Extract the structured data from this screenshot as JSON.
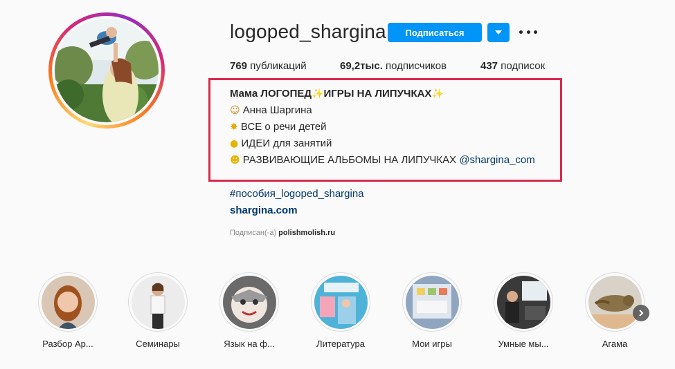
{
  "profile": {
    "username": "logoped_shargina",
    "follow_label": "Подписаться",
    "stats": {
      "posts_count": "769",
      "posts_label": "публикаций",
      "followers_count": "69,2тыс.",
      "followers_label": "подписчиков",
      "following_count": "437",
      "following_label": "подписок"
    },
    "bio": {
      "line1_a": "Мама ЛОГОПЕД",
      "line1_b": "ИГРЫ НА ЛИПУЧКАХ",
      "line1_icon": "sparkles-icon",
      "line2": "Анна Шаргина",
      "line2_icon": "woman-icon",
      "line3": "ВСЕ о речи детей",
      "line3_icon": "collision-icon",
      "line4": "ИДЕИ для занятий",
      "line4_icon": "lightbulb-icon",
      "line5": "РАЗВИВАЮЩИЕ АЛЬБОМЫ НА ЛИПУЧКАХ",
      "line5_mention": "@shargina_com",
      "line5_icon": "baby-icon"
    },
    "hashtag": "#пособия_logoped_shargina",
    "website": "shargina.com",
    "followed_by_prefix": "Подписан(-а)",
    "followed_by_user": "polishmolish.ru"
  },
  "highlights": [
    {
      "label": "Разбор Ар..."
    },
    {
      "label": "Семинары"
    },
    {
      "label": "Язык на ф..."
    },
    {
      "label": "Литература"
    },
    {
      "label": "Мои игры"
    },
    {
      "label": "Умные мы..."
    },
    {
      "label": "Агама"
    }
  ],
  "colors": {
    "accent": "#0095f6",
    "link": "#00376b",
    "highlight_box": "#d7294c"
  }
}
